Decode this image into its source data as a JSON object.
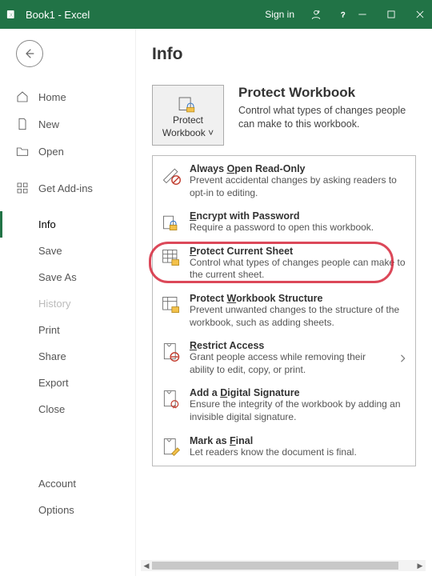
{
  "titlebar": {
    "app_icon_text": "X",
    "title": "Book1  -  Excel",
    "signin": "Sign in"
  },
  "sidebar": {
    "items": [
      {
        "label": "Home"
      },
      {
        "label": "New"
      },
      {
        "label": "Open"
      },
      {
        "label": "Get Add-ins"
      },
      {
        "label": "Info"
      },
      {
        "label": "Save"
      },
      {
        "label": "Save As"
      },
      {
        "label": "History"
      },
      {
        "label": "Print"
      },
      {
        "label": "Share"
      },
      {
        "label": "Export"
      },
      {
        "label": "Close"
      },
      {
        "label": "Account"
      },
      {
        "label": "Options"
      }
    ]
  },
  "main": {
    "page_title": "Info",
    "protect_button_line1": "Protect",
    "protect_button_line2": "Workbook",
    "section_title": "Protect Workbook",
    "section_desc": "Control what types of changes people can make to this workbook.",
    "options": [
      {
        "title_pre": "Always ",
        "title_key": "O",
        "title_post": "pen Read-Only",
        "desc": "Prevent accidental changes by asking readers to opt-in to editing."
      },
      {
        "title_pre": "",
        "title_key": "E",
        "title_post": "ncrypt with Password",
        "desc": "Require a password to open this workbook."
      },
      {
        "title_pre": "",
        "title_key": "P",
        "title_post": "rotect Current Sheet",
        "desc": "Control what types of changes people can make to the current sheet."
      },
      {
        "title_pre": "Protect ",
        "title_key": "W",
        "title_post": "orkbook Structure",
        "desc": "Prevent unwanted changes to the structure of the workbook, such as adding sheets."
      },
      {
        "title_pre": "",
        "title_key": "R",
        "title_post": "estrict Access",
        "desc": "Grant people access while removing their ability to edit, copy, or print."
      },
      {
        "title_pre": "Add a ",
        "title_key": "D",
        "title_post": "igital Signature",
        "desc": "Ensure the integrity of the workbook by adding an invisible digital signature."
      },
      {
        "title_pre": "Mark as ",
        "title_key": "F",
        "title_post": "inal",
        "desc": "Let readers know the document is final."
      }
    ]
  }
}
